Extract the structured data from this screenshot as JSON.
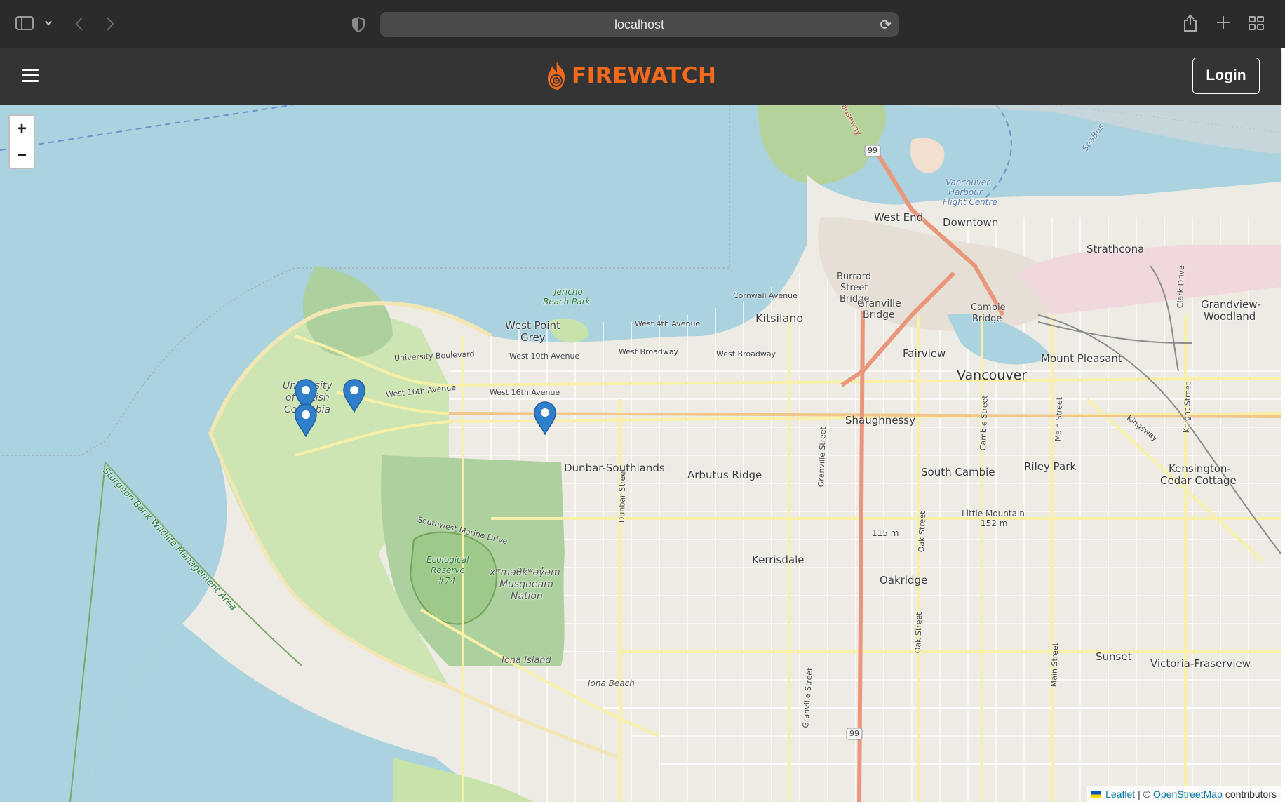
{
  "browser": {
    "url": "localhost",
    "icons": [
      "sidebar-icon",
      "chevron-down-icon",
      "back-icon",
      "forward-icon",
      "privacy-shield-icon",
      "reload-icon",
      "share-icon",
      "new-tab-icon",
      "tab-overview-icon"
    ]
  },
  "header": {
    "logo_text": "FIREWATCH",
    "login_label": "Login",
    "brand_color": "#f26a1b"
  },
  "map": {
    "zoom_in": "+",
    "zoom_out": "−",
    "labels": {
      "west_end": "West End",
      "downtown": "Downtown",
      "strathcona": "Strathcona",
      "harbour_1": "Vancouver",
      "harbour_2": "Harbour",
      "harbour_3": "Flight Centre",
      "burrard_1": "Burrard",
      "burrard_2": "Street",
      "burrard_3": "Bridge",
      "granville_bridge_1": "Granville",
      "granville_bridge_2": "Bridge",
      "cambie_bridge_1": "Cambie",
      "cambie_bridge_2": "Bridge",
      "grandview_1": "Grandview-",
      "grandview_2": "Woodland",
      "kitsilano": "Kitsilano",
      "west_point_grey_1": "West Point",
      "west_point_grey_2": "Grey",
      "jericho_1": "Jericho",
      "jericho_2": "Beach Park",
      "fairview": "Fairview",
      "mount_pleasant": "Mount Pleasant",
      "vancouver": "Vancouver",
      "shaughnessy": "Shaughnessy",
      "dunbar": "Dunbar-Southlands",
      "arbutus": "Arbutus Ridge",
      "south_cambie": "South Cambie",
      "riley_park": "Riley Park",
      "kensington_1": "Kensington-",
      "kensington_2": "Cedar Cottage",
      "ubc_1": "University",
      "ubc_2": "of British",
      "ubc_3": "Columbia",
      "eco_1": "Ecological",
      "eco_2": "Reserve",
      "eco_3": "#74",
      "little_mountain_1": "Little Mountain",
      "little_mountain_2": "152 m",
      "elev_115": "115 m",
      "kerrisdale": "Kerrisdale",
      "oakridge": "Oakridge",
      "musqueam_1": "xʷməθkʷəy̓əm",
      "musqueam_2": "Musqueam",
      "musqueam_3": "Nation",
      "iona_island": "Iona Island",
      "iona_beach": "Iona Beach",
      "sunset": "Sunset",
      "victoria_fraserview": "Victoria-Fraserview",
      "sturgeon": "Sturgeon Bank Wildlife Management Area",
      "cornwall": "Cornwall Avenue",
      "w4th": "West 4th Avenue",
      "wbroadway_1": "West Broadway",
      "wbroadway_2": "West Broadway",
      "w10th": "West 10th Avenue",
      "univ_blvd": "University Boulevard",
      "w16th_1": "West 16th Avenue",
      "w16th_2": "West 16th Avenue",
      "sw_marine": "Southwest Marine Drive",
      "granville_st_1": "Granville Street",
      "granville_st_2": "Granville Street",
      "dunbar_st": "Dunbar Street",
      "oak_st_1": "Oak Street",
      "oak_st_2": "Oak Street",
      "cambie_st": "Cambie Street",
      "main_st_1": "Main Street",
      "main_st_2": "Main Street",
      "knight_st": "Knight Street",
      "clark_dr": "Clark Drive",
      "kingsway": "Kingsway",
      "causeway": "Causeway",
      "seabus": "SeaBus",
      "hwy_99_1": "99",
      "hwy_99_2": "99"
    },
    "markers": 4,
    "attribution": {
      "leaflet": "Leaflet",
      "separator": "| ©",
      "osm": "OpenStreetMap",
      "contributors": "contributors"
    }
  }
}
